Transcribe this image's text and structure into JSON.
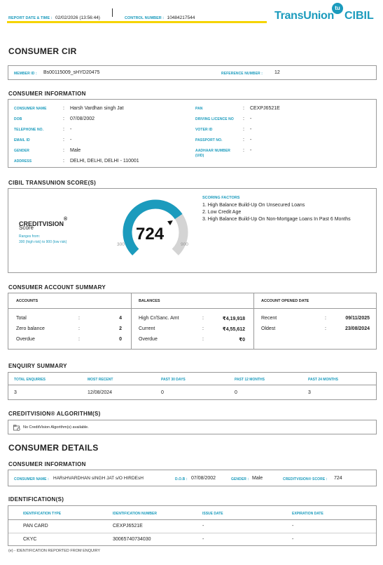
{
  "header": {
    "report_date_label": "REPORT DATE & TIME :",
    "report_date_value": "02/02/2026 (13:56:44)",
    "control_number_label": "CONTROL NUMBER :",
    "control_number_value": "10484217544",
    "logo_transunion": "TransUnion",
    "logo_cibil": "CIBIL",
    "logo_badge": "tu",
    "accent_color": "#f5d400",
    "brand_color": "#1b9bbd"
  },
  "title": "CONSUMER CIR",
  "member_row": {
    "member_id_label": "MEMBER ID :",
    "member_id_value": "Bs00115009_sHYD20475",
    "reference_label": "REFERENCE NUMBER :",
    "reference_value": "12"
  },
  "consumer_info": {
    "section_title": "CONSUMER INFORMATION",
    "left": [
      {
        "label": "CONSUMER NAME",
        "value": "Harsh Vardhan singh Jat"
      },
      {
        "label": "DOB",
        "value": "07/08/2002"
      },
      {
        "label": "TELEPHONE NO.",
        "value": "-"
      },
      {
        "label": "EMAIL ID",
        "value": "-"
      },
      {
        "label": "GENDER",
        "value": "Male"
      },
      {
        "label": "ADDRESS",
        "value": "DELHI, DELHI, DELHI - 110001"
      }
    ],
    "right": [
      {
        "label": "PAN",
        "value": "CEXPJ6521E"
      },
      {
        "label": "DRIVING LICENCE NO",
        "value": "-"
      },
      {
        "label": "VOTER ID",
        "value": "-"
      },
      {
        "label": "PASSPORT NO.",
        "value": "-"
      },
      {
        "label": "AADHAAR NUMBER",
        "label2": "(UID)",
        "value": "-"
      }
    ]
  },
  "score": {
    "section_title": "CIBIL TRANSUNION SCORE(S)",
    "name": "CREDITVISION",
    "reg": "®",
    "sub": "Score",
    "range_line1": "Ranges from:",
    "range_line2": "300 (high risk) to 900 (low risk)",
    "value": 724,
    "min": 300,
    "max": 900,
    "min_label": "300",
    "max_label": "900",
    "value_label": "724",
    "factors_title": "SCORING FACTORS",
    "factors": [
      "1. High Balance Build-Up On Unsecured Loans",
      "2. Low Credit Age",
      "3. High Balance Build-Up On Non-Mortgage Loans In Past 6 Months"
    ],
    "gauge_fill_color": "#1b9bbd",
    "gauge_empty_color": "#d4d4d4"
  },
  "account_summary": {
    "section_title": "CONSUMER ACCOUNT SUMMARY",
    "accounts": {
      "header": "ACCOUNTS",
      "rows": [
        {
          "label": "Total",
          "value": "4"
        },
        {
          "label": "Zero balance",
          "value": "2"
        },
        {
          "label": "Overdue",
          "value": "0"
        }
      ]
    },
    "balances": {
      "header": "BALANCES",
      "rows": [
        {
          "label": "High Cr/Sanc. Amt",
          "value": "₹4,19,918"
        },
        {
          "label": "Current",
          "value": "₹4,55,612"
        },
        {
          "label": "Overdue",
          "value": "₹0"
        }
      ]
    },
    "opened": {
      "header": "ACCOUNT OPENED DATE",
      "rows": [
        {
          "label": "Recent",
          "value": "09/11/2025"
        },
        {
          "label": "Oldest",
          "value": "23/08/2024"
        }
      ]
    }
  },
  "enquiry": {
    "section_title": "ENQUIRY SUMMARY",
    "headers": [
      "TOTAL ENQUIRIES",
      "MOST RECENT",
      "PAST 30 DAYS",
      "PAST 12 MONTHS",
      "PAST 24 MONTHS"
    ],
    "values": [
      "3",
      "12/08/2024",
      "0",
      "0",
      "3"
    ]
  },
  "algorithm": {
    "section_title": "CREDITVISION® ALGORITHM(S)",
    "message": "No CreditVision Algorithm(s) available."
  },
  "details": {
    "title": "CONSUMER DETAILS",
    "info_title": "CONSUMER INFORMATION",
    "name_label": "CONSUMER NAME :",
    "name_value": "HARsHVARDHAN sINGH JAT s/O HIRDEsH",
    "dob_label": "D.O.B :",
    "dob_value": "07/08/2002",
    "gender_label": "GENDER :",
    "gender_value": "Male",
    "score_label": "CREDITVISION® SCORE :",
    "score_value": "724"
  },
  "identification": {
    "section_title": "IDENTIFICATION(S)",
    "headers": [
      "IDENTIFICATION TYPE",
      "IDENTIFICATION NUMBER",
      "ISSUE DATE",
      "EXPIRATION DATE"
    ],
    "rows": [
      [
        "PAN CARD",
        "CEXPJ6521E",
        "-",
        "-"
      ],
      [
        "CKYC",
        "30065740734030",
        "-",
        "-"
      ]
    ],
    "footnote": "(e) - IDENTIFICATION REPORTED FROM ENQUIRY"
  }
}
